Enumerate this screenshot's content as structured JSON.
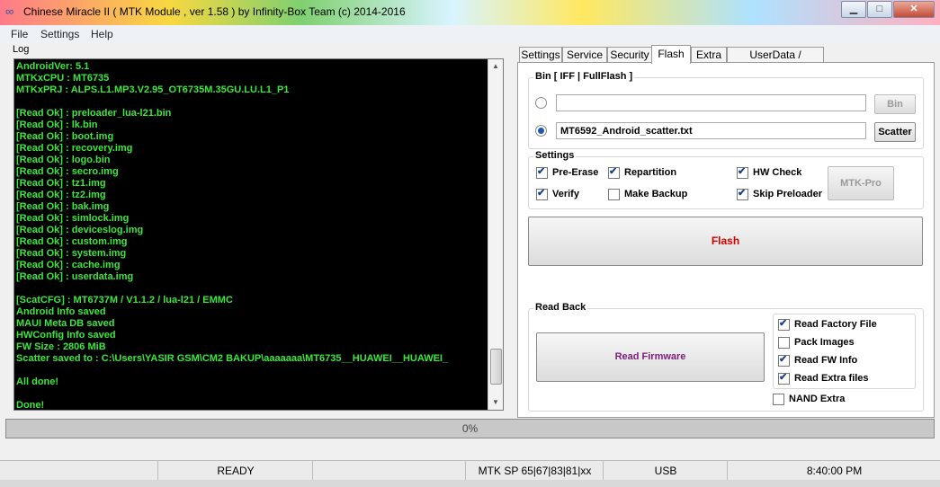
{
  "window": {
    "title": "Chinese Miracle II ( MTK Module , ver 1.58 ) by Infinity-Box Team (c) 2014-2016",
    "minimize": "▁",
    "maximize": "□",
    "close": "✕"
  },
  "menu": {
    "file": "File",
    "settings": "Settings",
    "help": "Help"
  },
  "log": {
    "label": "Log",
    "lines": [
      "AndroidVer: 5.1",
      "MTKxCPU : MT6735",
      "MTKxPRJ : ALPS.L1.MP3.V2.95_OT6735M.35GU.LU.L1_P1",
      "",
      "[Read Ok] : preloader_lua-l21.bin",
      "[Read Ok] : lk.bin",
      "[Read Ok] : boot.img",
      "[Read Ok] : recovery.img",
      "[Read Ok] : logo.bin",
      "[Read Ok] : secro.img",
      "[Read Ok] : tz1.img",
      "[Read Ok] : tz2.img",
      "[Read Ok] : bak.img",
      "[Read Ok] : simlock.img",
      "[Read Ok] : deviceslog.img",
      "[Read Ok] : custom.img",
      "[Read Ok] : system.img",
      "[Read Ok] : cache.img",
      "[Read Ok] : userdata.img",
      "",
      "[ScatCFG] : MT6737M / V1.1.2 / lua-l21 / EMMC",
      "Android Info saved",
      "MAUI Meta DB saved",
      "HWConfig Info saved",
      "FW Size : 2806 MiB",
      "Scatter saved to : C:\\Users\\YASIR GSM\\CM2 BAKUP\\aaaaaaa\\MT6735__HUAWEI__HUAWEI_",
      "",
      "All done!",
      "",
      "Done!"
    ]
  },
  "tabs": [
    "Settings",
    "Service",
    "Security",
    "Flash",
    "Extra",
    "UserData / Forensic"
  ],
  "active_tab": "Flash",
  "bin_group": {
    "label": "Bin [ IFF | FullFlash ]",
    "bin_path": "",
    "bin_button": "Bin",
    "scatter_path": "MT6592_Android_scatter.txt",
    "scatter_button": "Scatter"
  },
  "settings_group": {
    "label": "Settings",
    "pre_erase": "Pre-Erase",
    "repartition": "Repartition",
    "hw_check": "HW Check",
    "verify": "Verify",
    "make_backup": "Make Backup",
    "skip_preloader": "Skip Preloader",
    "mtk_pro": "MTK-Pro"
  },
  "flash_button": "Flash",
  "readback_group": {
    "label": "Read Back",
    "read_firmware": "Read Firmware",
    "read_factory_file": "Read Factory File",
    "pack_images": "Pack Images",
    "read_fw_info": "Read FW Info",
    "read_extra_files": "Read Extra files",
    "nand_extra": "NAND Extra"
  },
  "progress": {
    "percent": 0,
    "label": "0%"
  },
  "status": {
    "state": "READY",
    "mtk_sp": "MTK SP 65|67|83|81|xx",
    "connection": "USB",
    "time": "8:40:00 PM"
  },
  "colors": {
    "log_text": "#3ce63c",
    "flash_label": "#d00000",
    "read_firmware_label": "#7a1e7a",
    "check_mark": "#1a3f8a"
  }
}
